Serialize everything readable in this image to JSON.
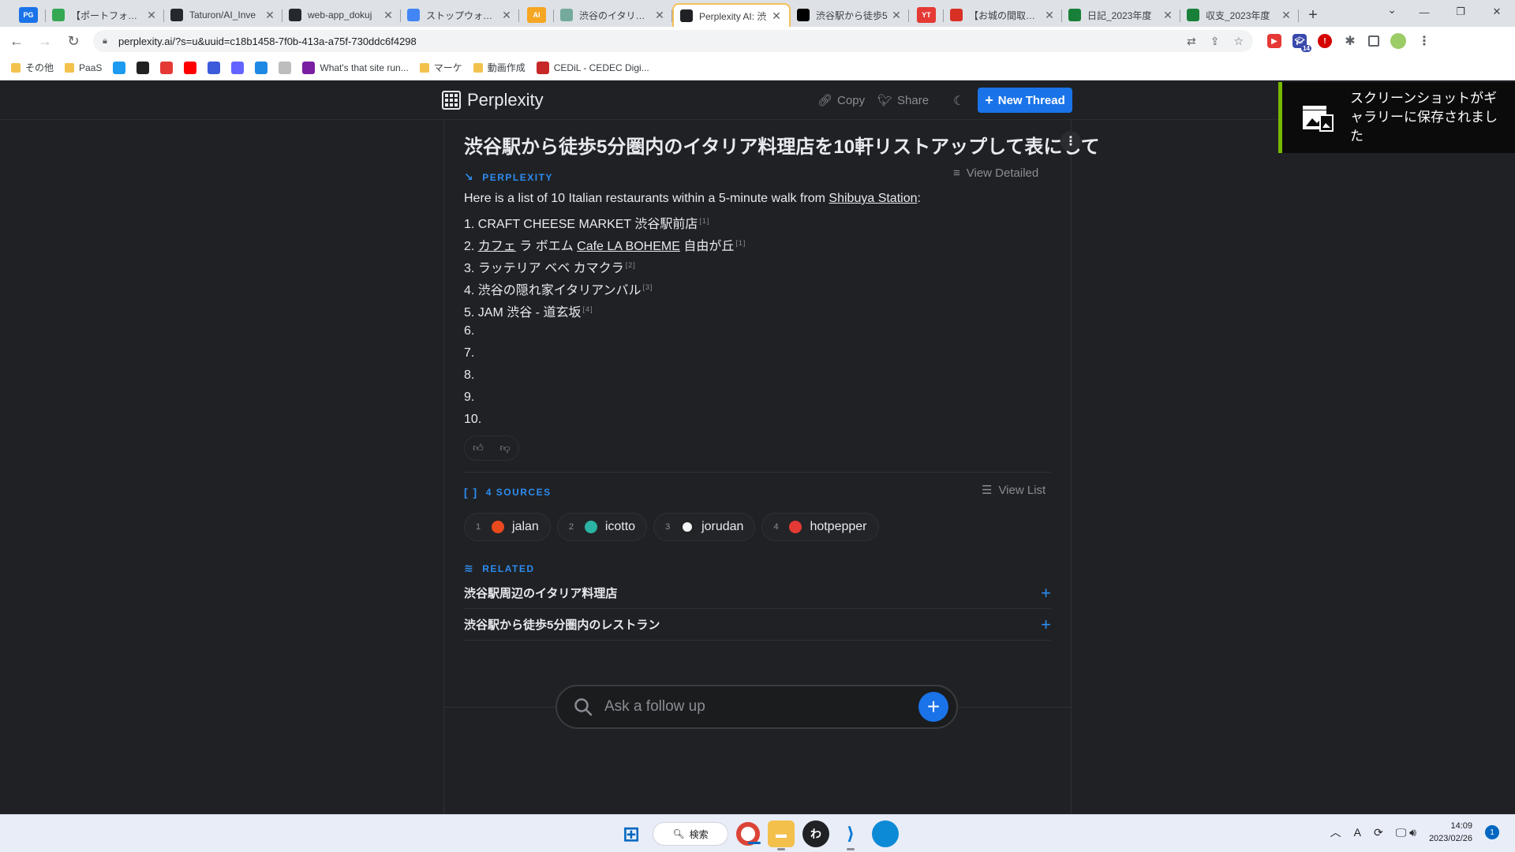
{
  "browser": {
    "tabs": [
      {
        "title": "PG",
        "icon": "pg-app-icon",
        "color": "#1a73e8",
        "small": true
      },
      {
        "title": "【ポートフォリオ】Pl",
        "icon": "portfolio-icon",
        "color": "#34a853"
      },
      {
        "title": "Taturon/AI_Inve",
        "icon": "github-icon",
        "color": "#24292f"
      },
      {
        "title": "web-app_dokuj",
        "icon": "github-icon",
        "color": "#24292f"
      },
      {
        "title": "ストップウォッチ",
        "icon": "stopwatch-icon",
        "color": "#4285f4"
      },
      {
        "title": "AI",
        "icon": "ai-group-icon",
        "color": "#f5a623",
        "small": true
      },
      {
        "title": "渋谷のイタリア料理",
        "icon": "chatgpt-icon",
        "color": "#74aa9c"
      },
      {
        "title": "Perplexity AI: 渋",
        "icon": "perplexity-icon",
        "color": "#202124",
        "active": true
      },
      {
        "title": "渋谷駅から徒歩5",
        "icon": "notion-icon",
        "color": "#000000"
      },
      {
        "title": "YT",
        "icon": "youtube-group-icon",
        "color": "#e53935",
        "small": true
      },
      {
        "title": "【お城の間取りは",
        "icon": "zenn-icon",
        "color": "#d93025"
      },
      {
        "title": "日記_2023年度",
        "icon": "sheets-icon",
        "color": "#188038"
      },
      {
        "title": "収支_2023年度",
        "icon": "sheets-icon",
        "color": "#188038"
      }
    ],
    "url": "perplexity.ai/?s=u&uuid=c18b1458-7f0b-413a-a75f-730ddc6f4298",
    "extensions_badge": "14",
    "bookmarks": [
      {
        "label": "その他",
        "type": "folder"
      },
      {
        "label": "PaaS",
        "type": "folder"
      },
      {
        "label": "",
        "type": "twitter",
        "color": "#1d9bf0"
      },
      {
        "label": "",
        "type": "note",
        "color": "#222222"
      },
      {
        "label": "",
        "type": "app",
        "color": "#e53935"
      },
      {
        "label": "",
        "type": "youtube",
        "color": "#ff0000"
      },
      {
        "label": "",
        "type": "app",
        "color": "#3b5bdb"
      },
      {
        "label": "",
        "type": "mastodon",
        "color": "#6364ff"
      },
      {
        "label": "",
        "type": "cw",
        "color": "#1e88e5"
      },
      {
        "label": "",
        "type": "app",
        "color": "#bdbdbd"
      },
      {
        "label": "What's that site run...",
        "type": "site",
        "color": "#7b1fa2"
      },
      {
        "label": "マーケ",
        "type": "folder"
      },
      {
        "label": "動画作成",
        "type": "folder"
      },
      {
        "label": "CEDiL - CEDEC Digi...",
        "type": "site",
        "color": "#c62828"
      }
    ]
  },
  "app": {
    "brand": "Perplexity",
    "copy_label": "Copy",
    "share_label": "Share",
    "new_thread_label": "New Thread",
    "question": "渋谷駅から徒歩5分圏内のイタリア料理店を10軒リストアップして表にして",
    "answer_label": "PERPLEXITY",
    "view_detailed": "View Detailed",
    "answer_intro_pre": "Here is a list of 10 Italian restaurants within a 5-minute walk from ",
    "answer_intro_link": "Shibuya Station",
    "answer_intro_post": ":",
    "items": [
      {
        "text": "1. CRAFT CHEESE MARKET 渋谷駅前店",
        "cite": "[1]"
      },
      {
        "pre": "2. ",
        "link1": "カフェ",
        "mid": " ラ ボエム ",
        "link2": "Cafe LA BOHEME",
        "post": " 自由が丘",
        "cite": "[1]"
      },
      {
        "text": "3. ラッテリア ベベ カマクラ",
        "cite": "[2]"
      },
      {
        "text": "4. 渋谷の隠れ家イタリアンバル",
        "cite": "[3]"
      },
      {
        "text": "5. JAM 渋谷 - 道玄坂",
        "cite": "[4]"
      },
      {
        "text": "6.",
        "cite": ""
      },
      {
        "text": "7.",
        "cite": ""
      },
      {
        "text": "8.",
        "cite": ""
      },
      {
        "text": "9.",
        "cite": ""
      },
      {
        "text": "10.",
        "cite": ""
      }
    ],
    "sources_label": "4 SOURCES",
    "view_list": "View List",
    "sources": [
      {
        "num": "1",
        "name": "jalan",
        "color": "#e8491d"
      },
      {
        "num": "2",
        "name": "icotto",
        "color": "#2bb3a3"
      },
      {
        "num": "3",
        "name": "jorudan",
        "color": "#f5f5f5"
      },
      {
        "num": "4",
        "name": "hotpepper",
        "color": "#e53935"
      }
    ],
    "related_label": "RELATED",
    "related": [
      "渋谷駅周辺のイタリア料理店",
      "渋谷駅から徒歩5分圏内のレストラン"
    ],
    "followup_placeholder": "Ask a follow up"
  },
  "toast": {
    "message": "スクリーンショットがギャラリーに保存されました"
  },
  "taskbar": {
    "search_label": "検索",
    "time": "14:09",
    "date": "2023/02/26",
    "notifications": "1"
  }
}
